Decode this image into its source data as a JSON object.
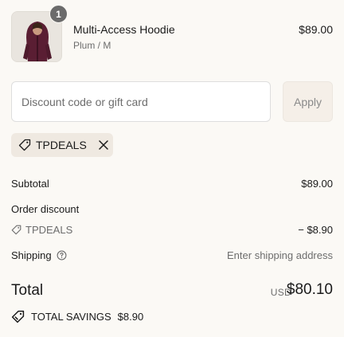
{
  "line_item": {
    "quantity": "1",
    "name": "Multi-Access Hoodie",
    "variant": "Plum / M",
    "price": "$89.00",
    "image_color": "#5a1e33"
  },
  "discount": {
    "placeholder": "Discount code or gift card",
    "apply_label": "Apply",
    "applied_code": "TPDEALS"
  },
  "summary": {
    "subtotal_label": "Subtotal",
    "subtotal_value": "$89.00",
    "order_discount_label": "Order discount",
    "discount_code": "TPDEALS",
    "discount_value": "− $8.90",
    "shipping_label": "Shipping",
    "shipping_value": "Enter shipping address"
  },
  "total": {
    "label": "Total",
    "currency": "USD",
    "amount": "$80.10",
    "savings_label": "TOTAL SAVINGS",
    "savings_value": "$8.90"
  },
  "icons": [
    "tag-icon",
    "close-icon",
    "help-icon",
    "savings-tag-icon"
  ]
}
